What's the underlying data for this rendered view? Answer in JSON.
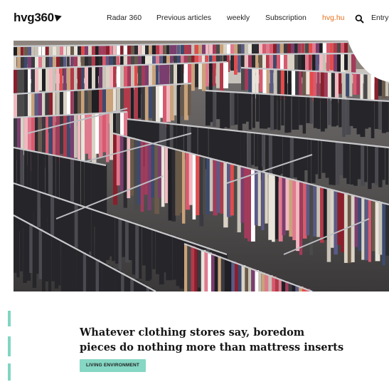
{
  "header": {
    "logo": "hvg360",
    "nav": [
      {
        "label": "Radar 360"
      },
      {
        "label": "Previous articles"
      },
      {
        "label": "weekly"
      },
      {
        "label": "Subscription"
      },
      {
        "label": "hvg.hu"
      }
    ],
    "entry_label": "Entry",
    "accent_color": "#e8711c"
  },
  "hero": {
    "image": "clothing-store-racks-photo"
  },
  "article": {
    "headline_line1": "Whatever clothing stores say, boredom",
    "headline_line2": "pieces do nothing more than mattress inserts",
    "tag": "LIVING ENVIRONMENT",
    "tag_color": "#86d7c4"
  }
}
